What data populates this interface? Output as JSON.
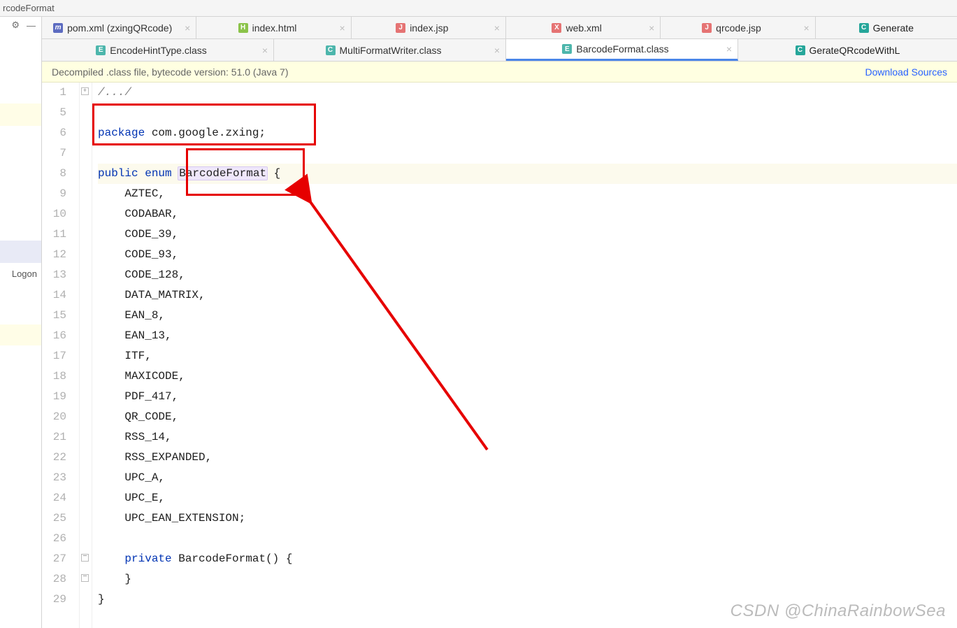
{
  "window_title": "rcodeFormat",
  "toolbar_icons": {
    "gear": "⚙",
    "minimize": "—"
  },
  "left_panel_text": "Logon",
  "tabs_row1": [
    {
      "icon": "m",
      "label": "pom.xml (zxingQRcode)"
    },
    {
      "icon": "html",
      "label": "index.html"
    },
    {
      "icon": "jsp",
      "label": "index.jsp"
    },
    {
      "icon": "jsp",
      "label": "web.xml"
    },
    {
      "icon": "jsp",
      "label": "qrcode.jsp"
    },
    {
      "icon": "class",
      "label": "Generate"
    }
  ],
  "tabs_row2": [
    {
      "icon": "c-e",
      "label": "EncodeHintType.class",
      "active": false
    },
    {
      "icon": "c-e",
      "label": "MultiFormatWriter.class",
      "active": false
    },
    {
      "icon": "c-e",
      "label": "BarcodeFormat.class",
      "active": true
    },
    {
      "icon": "class",
      "label": "GerateQRcodeWithL",
      "active": false
    }
  ],
  "banner": {
    "text": "Decompiled .class file, bytecode version: 51.0 (Java 7)",
    "link": "Download Sources"
  },
  "line_numbers": [
    "1",
    "5",
    "6",
    "7",
    "8",
    "9",
    "10",
    "11",
    "12",
    "13",
    "14",
    "15",
    "16",
    "17",
    "18",
    "19",
    "20",
    "21",
    "22",
    "23",
    "24",
    "25",
    "26",
    "27",
    "28",
    "29"
  ],
  "code": {
    "comment": "/.../",
    "kw_package": "package",
    "pkg": " com.google.zxing;",
    "kw_public": "public",
    "kw_enum": " enum ",
    "enum_name": "BarcodeFormat",
    "open": " {",
    "values": [
      "AZTEC,",
      "CODABAR,",
      "CODE_39,",
      "CODE_93,",
      "CODE_128,",
      "DATA_MATRIX,",
      "EAN_8,",
      "EAN_13,",
      "ITF,",
      "MAXICODE,",
      "PDF_417,",
      "QR_CODE,",
      "RSS_14,",
      "RSS_EXPANDED,",
      "UPC_A,",
      "UPC_E,",
      "UPC_EAN_EXTENSION;"
    ],
    "kw_private": "private",
    "ctor": " BarcodeFormat() {",
    "close_inner": "    }",
    "close_outer": "}"
  },
  "watermark": "CSDN @ChinaRainbowSea"
}
